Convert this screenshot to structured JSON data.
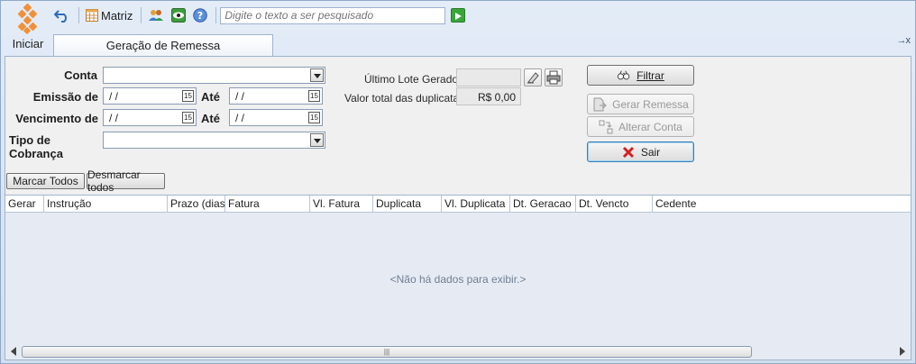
{
  "start": {
    "label": "Iniciar"
  },
  "toolbar": {
    "matriz_label": "Matriz",
    "search_placeholder": "Digite o texto a ser pesquisado"
  },
  "tab": {
    "label": "Geração de Remessa",
    "close_glyph": "→x"
  },
  "form": {
    "conta_label": "Conta",
    "emissao_label": "Emissão de",
    "vencimento_label": "Vencimento de",
    "ate_label": "Até",
    "tipo_cobranca_label": "Tipo de Cobrança",
    "date_placeholder": " / /",
    "cal_glyph": "15",
    "ultimo_lote_label": "Último Lote Gerado",
    "ultimo_lote_value": "",
    "valor_total_label": "Valor total das duplicatas",
    "valor_total_value": "R$ 0,00"
  },
  "buttons": {
    "filtrar": "Filtrar",
    "gerar_remessa": "Gerar Remessa",
    "alterar_conta": "Alterar Conta",
    "sair": "Sair",
    "marcar_todos": "Marcar Todos",
    "desmarcar_todos": "Desmarcar todos"
  },
  "grid": {
    "columns": [
      {
        "label": "Gerar"
      },
      {
        "label": "Instrução"
      },
      {
        "label": "Prazo (dias)"
      },
      {
        "label": "Fatura"
      },
      {
        "label": "Vl. Fatura"
      },
      {
        "label": "Duplicata"
      },
      {
        "label": "Vl. Duplicata"
      },
      {
        "label": "Dt. Geracao"
      },
      {
        "label": "Dt. Vencto"
      },
      {
        "label": "Cedente"
      }
    ],
    "empty_message": "<Não há dados para exibir.>"
  },
  "colors": {
    "accent": "#f0913a",
    "border": "#9fb3cd",
    "sair_icon": "#d42020"
  }
}
